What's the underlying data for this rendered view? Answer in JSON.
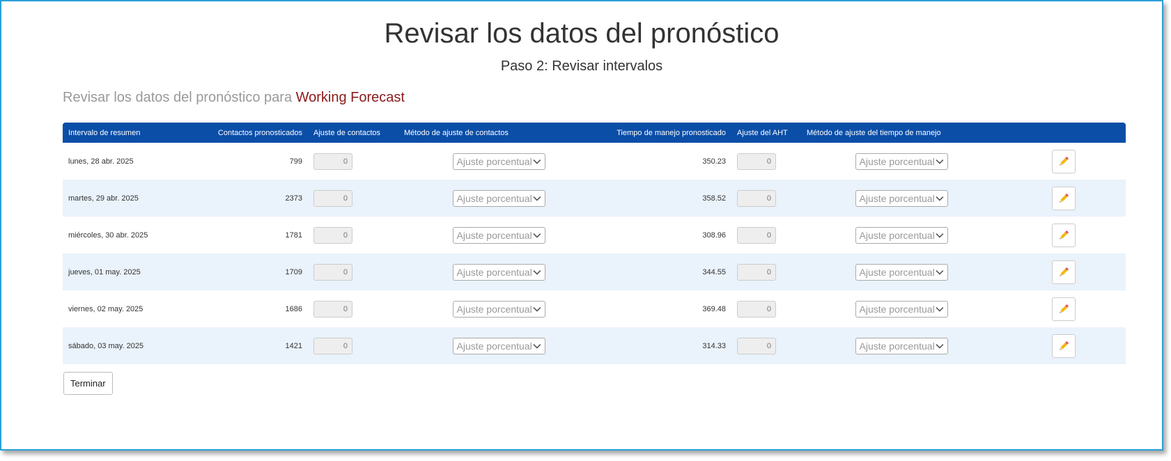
{
  "header": {
    "title": "Revisar los datos del pronóstico",
    "subtitle": "Paso 2: Revisar intervalos",
    "review_prefix": "Revisar los datos del pronóstico para",
    "forecast_name": "Working Forecast"
  },
  "colors": {
    "header_bg": "#0a4ea8",
    "row_alt_bg": "#eaf2fb",
    "forecast_name": "#8b1a1a",
    "frame_border": "#2a9fd6"
  },
  "table": {
    "columns": [
      "Intervalo de resumen",
      "Contactos pronosticados",
      "Ajuste de contactos",
      "Método de ajuste de contactos",
      "Tiempo de manejo pronosticado",
      "Ajuste del AHT",
      "Método de ajuste del tiempo de manejo"
    ],
    "rows": [
      {
        "interval": "lunes, 28 abr. 2025",
        "contacts": "799",
        "contact_adj": "0",
        "contact_method": "Ajuste porcentual",
        "handle_time": "350.23",
        "aht_adj": "0",
        "aht_method": "Ajuste porcentual"
      },
      {
        "interval": "martes, 29 abr. 2025",
        "contacts": "2373",
        "contact_adj": "0",
        "contact_method": "Ajuste porcentual",
        "handle_time": "358.52",
        "aht_adj": "0",
        "aht_method": "Ajuste porcentual"
      },
      {
        "interval": "miércoles, 30 abr. 2025",
        "contacts": "1781",
        "contact_adj": "0",
        "contact_method": "Ajuste porcentual",
        "handle_time": "308.96",
        "aht_adj": "0",
        "aht_method": "Ajuste porcentual"
      },
      {
        "interval": "jueves, 01 may. 2025",
        "contacts": "1709",
        "contact_adj": "0",
        "contact_method": "Ajuste porcentual",
        "handle_time": "344.55",
        "aht_adj": "0",
        "aht_method": "Ajuste porcentual"
      },
      {
        "interval": "viernes, 02 may. 2025",
        "contacts": "1686",
        "contact_adj": "0",
        "contact_method": "Ajuste porcentual",
        "handle_time": "369.48",
        "aht_adj": "0",
        "aht_method": "Ajuste porcentual"
      },
      {
        "interval": "sábado, 03 may. 2025",
        "contacts": "1421",
        "contact_adj": "0",
        "contact_method": "Ajuste porcentual",
        "handle_time": "314.33",
        "aht_adj": "0",
        "aht_method": "Ajuste porcentual"
      }
    ],
    "row_action_icon": "pencil-icon"
  },
  "footer": {
    "finish_label": "Terminar"
  }
}
